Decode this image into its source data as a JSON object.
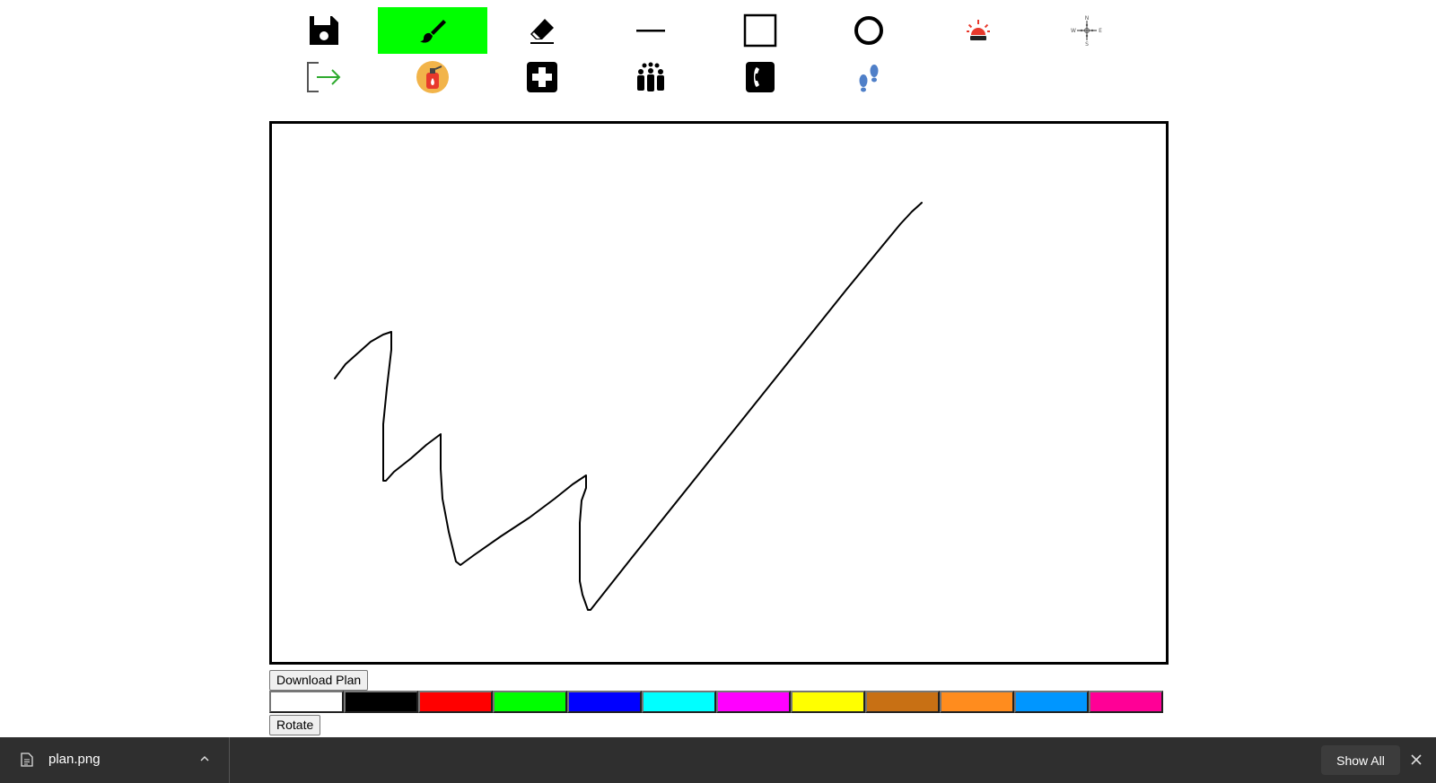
{
  "toolbar": {
    "tools": [
      {
        "name": "save",
        "icon": "floppy-disk-icon",
        "active": false
      },
      {
        "name": "brush",
        "icon": "paintbrush-icon",
        "active": true
      },
      {
        "name": "eraser",
        "icon": "eraser-icon",
        "active": false
      },
      {
        "name": "line",
        "icon": "line-icon",
        "active": false
      },
      {
        "name": "rectangle",
        "icon": "square-outline-icon",
        "active": false
      },
      {
        "name": "circle",
        "icon": "circle-outline-icon",
        "active": false
      },
      {
        "name": "alarm",
        "icon": "siren-icon",
        "active": false
      },
      {
        "name": "compass",
        "icon": "compass-rose-icon",
        "active": false
      },
      {
        "name": "exit",
        "icon": "exit-door-icon",
        "active": false
      },
      {
        "name": "fire-extinguisher",
        "icon": "fire-extinguisher-icon",
        "active": false
      },
      {
        "name": "first-aid",
        "icon": "first-aid-cross-icon",
        "active": false
      },
      {
        "name": "assembly-point",
        "icon": "people-group-icon",
        "active": false
      },
      {
        "name": "phone",
        "icon": "phone-icon",
        "active": false
      },
      {
        "name": "evacuation-route",
        "icon": "footprints-icon",
        "active": false
      }
    ],
    "compass_letters": {
      "n": "N",
      "s": "S",
      "e": "E",
      "w": "W"
    },
    "active_color": "#00ff00"
  },
  "canvas": {
    "stroke_color": "#000000"
  },
  "buttons": {
    "download_label": "Download Plan",
    "rotate_label": "Rotate"
  },
  "palette": {
    "colors": [
      "#ffffff",
      "#000000",
      "#ff0000",
      "#00ff00",
      "#0000ff",
      "#00ffff",
      "#ff00ff",
      "#ffff00",
      "#c87014",
      "#ff8c1e",
      "#0096ff",
      "#ff0096"
    ]
  },
  "downloads_bar": {
    "file_name": "plan.png",
    "file_icon": "document-icon",
    "chevron_icon": "chevron-up-icon",
    "show_all_label": "Show All",
    "close_icon": "close-icon"
  }
}
